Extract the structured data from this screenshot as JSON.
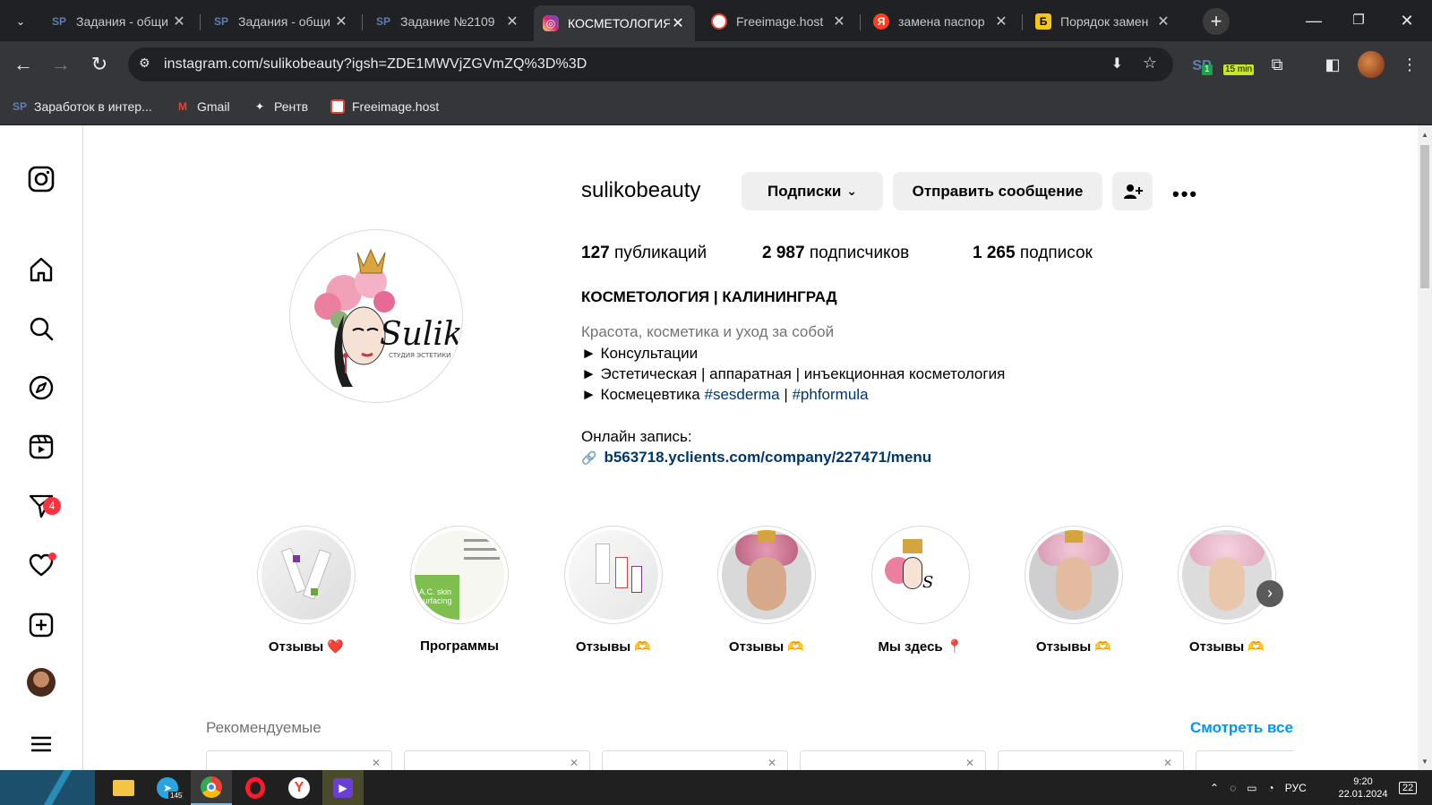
{
  "browser": {
    "tabs": [
      {
        "title": "Задания - общи",
        "favicon": "sp-icon",
        "favcolor": "#5d7fb5"
      },
      {
        "title": "Задания - общи",
        "favicon": "sp-icon",
        "favcolor": "#5d7fb5"
      },
      {
        "title": "Задание №2109",
        "favicon": "sp-icon",
        "favcolor": "#5d7fb5"
      },
      {
        "title": "КОСМЕТОЛОГИЯ",
        "favicon": "instagram-icon",
        "favcolor": "#d6249f"
      },
      {
        "title": "Freeimage.host",
        "favicon": "freeimage-icon",
        "favcolor": "#e0443a"
      },
      {
        "title": "замена паспор",
        "favicon": "yandex-icon",
        "favcolor": "#fc3f1d"
      },
      {
        "title": "Порядок замен",
        "favicon": "b-icon",
        "favcolor": "#f5c518"
      }
    ],
    "url": "instagram.com/sulikobeauty?igsh=ZDE1MWVjZGVmZQ%3D%3D",
    "extension_badge_1": "1",
    "extension_badge_2": "15 min",
    "bookmarks": [
      {
        "label": "Заработок в интер...",
        "icon": "sp-icon"
      },
      {
        "label": "Gmail",
        "icon": "gmail-icon"
      },
      {
        "label": "Рентв",
        "icon": "rentv-icon"
      },
      {
        "label": "Freeimage.host",
        "icon": "freeimage-icon"
      }
    ]
  },
  "sidebar": {
    "notifications_badge": "4"
  },
  "profile": {
    "username": "sulikobeauty",
    "follow_button": "Подписки",
    "message_button": "Отправить сообщение",
    "stats": {
      "posts_count": "127",
      "posts_label": "публикаций",
      "followers_count": "2 987",
      "followers_label": "подписчиков",
      "following_count": "1 265",
      "following_label": "подписок"
    },
    "name": "КОСМЕТОЛОГИЯ | КАЛИНИНГРАД",
    "category": "Красота, косметика и уход за собой",
    "bio_lines": [
      "► Консультации",
      "► Эстетическая | аппаратная | инъекционная косметология"
    ],
    "bio_line3_prefix": "► Космецевтика ",
    "hashtag1": "#sesderma",
    "bio_sep": " | ",
    "hashtag2": "#phformula",
    "booking_label": "Онлайн запись:",
    "link": "b563718.yclients.com/company/227471/menu",
    "logo_text": "Suliko",
    "logo_subtext": "СТУДИЯ ЭСТЕТИКИ"
  },
  "highlights": [
    {
      "label": "Отзывы ❤️"
    },
    {
      "label": "Программы"
    },
    {
      "label": "Отзывы 🫶"
    },
    {
      "label": "Отзывы 🫶"
    },
    {
      "label": "Мы здесь 📍"
    },
    {
      "label": "Отзывы 🫶"
    },
    {
      "label": "Отзывы 🫶"
    }
  ],
  "highlight_2_text": "A.C. skin surfacing",
  "suggested": {
    "title": "Рекомендуемые",
    "see_all": "Смотреть все"
  },
  "taskbar": {
    "telegram_badge": "145",
    "lang": "РУС",
    "time": "9:20",
    "date": "22.01.2024",
    "notif_count": "22"
  }
}
